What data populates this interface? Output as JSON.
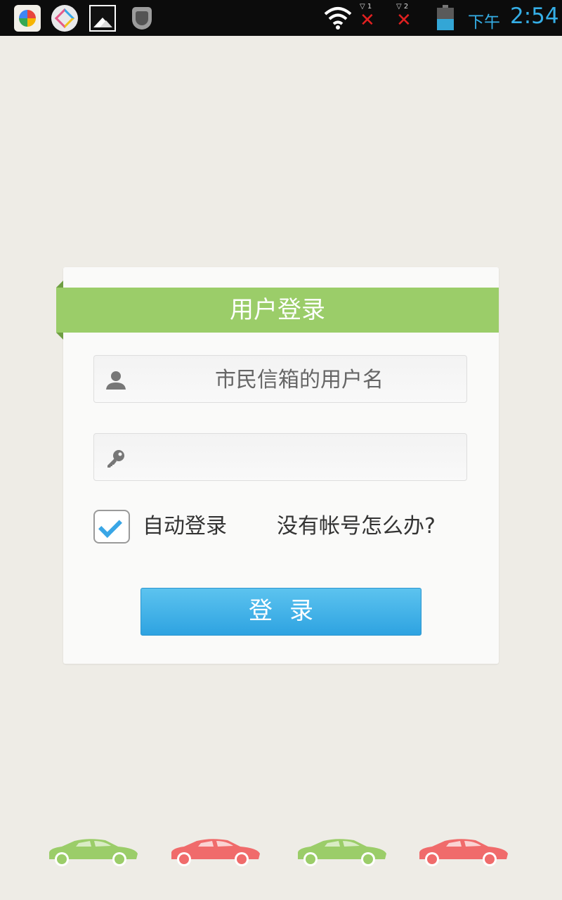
{
  "status_bar": {
    "icons": [
      "photo-app-icon",
      "puzzle-app-icon",
      "gallery-icon",
      "security-shield-icon",
      "wifi-icon",
      "signal-1-icon",
      "signal-2-icon",
      "battery-icon"
    ],
    "sim1_label": "1",
    "sim2_label": "2",
    "time_prefix": "下午",
    "time": "2:54"
  },
  "login": {
    "title": "用户登录",
    "username_placeholder": "市民信箱的用户名",
    "password_placeholder": "",
    "auto_login_label": "自动登录",
    "auto_login_checked": true,
    "no_account_link": "没有帐号怎么办?",
    "submit_label": "登录"
  },
  "footer": {
    "cars": [
      {
        "icon": "car-icon",
        "color": "#9bcd69"
      },
      {
        "icon": "car-icon",
        "color": "#f06b6b"
      },
      {
        "icon": "car-icon",
        "color": "#9bcd69"
      },
      {
        "icon": "car-icon",
        "color": "#f06b6b"
      }
    ]
  },
  "colors": {
    "background": "#eeece6",
    "accent_green": "#9bcd69",
    "button_blue": "#3aaee6",
    "car_red": "#f06b6b"
  }
}
